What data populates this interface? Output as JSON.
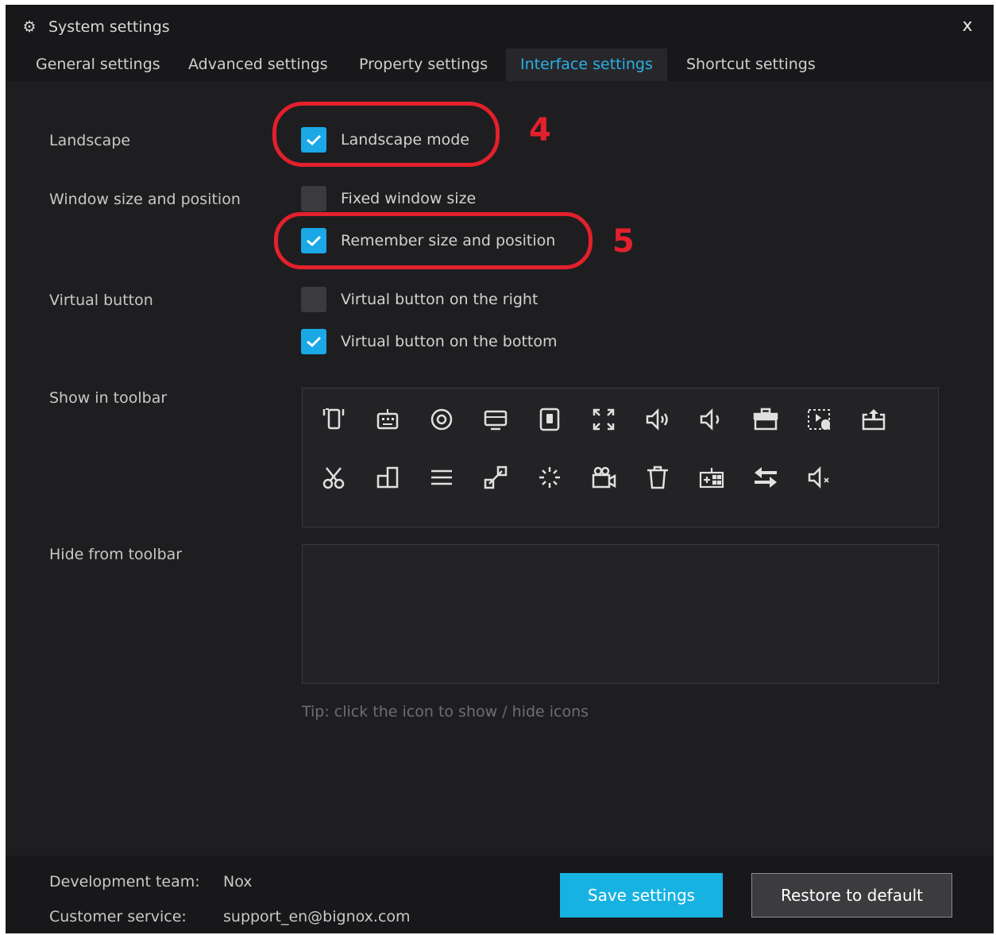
{
  "window": {
    "title": "System settings",
    "title_icon": "gear-icon",
    "close_label": "x"
  },
  "tabs": [
    {
      "label": "General settings",
      "active": false
    },
    {
      "label": "Advanced settings",
      "active": false
    },
    {
      "label": "Property settings",
      "active": false
    },
    {
      "label": "Interface settings",
      "active": true
    },
    {
      "label": "Shortcut settings",
      "active": false
    }
  ],
  "landscape": {
    "label": "Landscape",
    "options": [
      {
        "label": "Landscape mode",
        "checked": true
      }
    ]
  },
  "window_size": {
    "label": "Window size and position",
    "options": [
      {
        "label": "Fixed window size",
        "checked": false
      },
      {
        "label": "Remember size and position",
        "checked": true
      }
    ]
  },
  "virtual_button": {
    "label": "Virtual button",
    "options": [
      {
        "label": "Virtual button on the right",
        "checked": false
      },
      {
        "label": "Virtual button on the bottom",
        "checked": true
      }
    ]
  },
  "show_toolbar": {
    "label": "Show in toolbar",
    "icons": [
      "shake-icon",
      "keyboard-icon",
      "location-icon",
      "screen-icon",
      "phone-icon",
      "fullscreen-icon",
      "volume-up-icon",
      "volume-down-icon",
      "toolbox-icon",
      "macro-icon",
      "apk-install-icon",
      "scissors-icon",
      "multi-instance-icon",
      "menu-icon",
      "expand-icon",
      "loading-icon",
      "video-record-icon",
      "trash-icon",
      "keymap-icon",
      "sync-icon",
      "mute-icon"
    ]
  },
  "hide_toolbar": {
    "label": "Hide from toolbar"
  },
  "tip": "Tip: click the icon to show / hide icons",
  "annotations": [
    "4",
    "5"
  ],
  "footer": {
    "dev_label": "Development team:",
    "dev_value": "Nox",
    "cs_label": "Customer service:",
    "cs_value": "support_en@bignox.com",
    "save_label": "Save settings",
    "restore_label": "Restore to default"
  },
  "colors": {
    "accent": "#1aa8e6",
    "annotation": "#e3202c",
    "background": "#1e1e20"
  }
}
